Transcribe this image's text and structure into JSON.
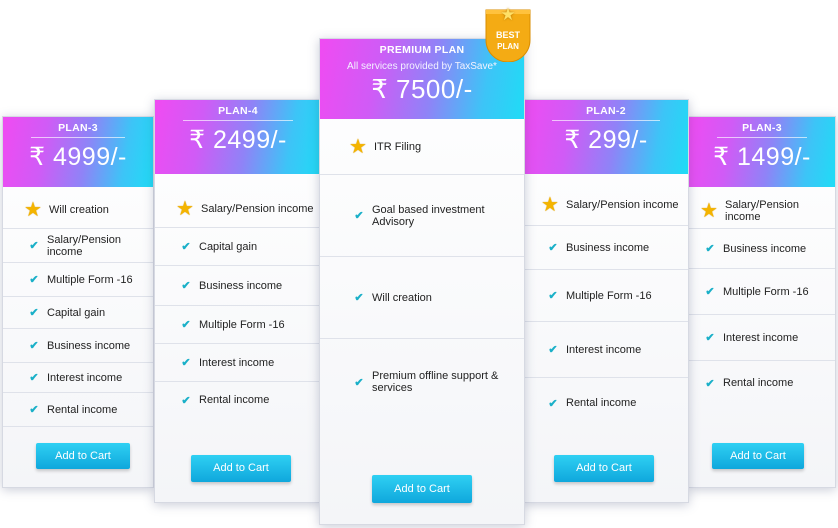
{
  "badge": {
    "line1": "BEST",
    "line2": "PLAN"
  },
  "plans": [
    {
      "name": "PLAN-3",
      "price": "₹ 4999/-",
      "features": [
        {
          "label": "Will creation",
          "icon": "star-icon"
        },
        {
          "label": "Salary/Pension income",
          "icon": "check-icon"
        },
        {
          "label": "Multiple Form -16",
          "icon": "check-icon"
        },
        {
          "label": "Capital gain",
          "icon": "check-icon"
        },
        {
          "label": "Business income",
          "icon": "check-icon"
        },
        {
          "label": "Interest income",
          "icon": "check-icon"
        },
        {
          "label": "Rental income",
          "icon": "check-icon"
        }
      ],
      "button": "Add to Cart"
    },
    {
      "name": "PLAN-4",
      "price": "₹ 2499/-",
      "features": [
        {
          "label": "Salary/Pension income",
          "icon": "star-icon"
        },
        {
          "label": "Capital gain",
          "icon": "check-icon"
        },
        {
          "label": "Business income",
          "icon": "check-icon"
        },
        {
          "label": "Multiple Form -16",
          "icon": "check-icon"
        },
        {
          "label": "Interest income",
          "icon": "check-icon"
        },
        {
          "label": "Rental income",
          "icon": "check-icon"
        }
      ],
      "button": "Add to Cart"
    },
    {
      "name": "PREMIUM PLAN",
      "subtitle": "All services provided by TaxSave*",
      "price": "₹ 7500/-",
      "features": [
        {
          "label": "ITR Filing",
          "icon": "star-icon"
        },
        {
          "label": "Goal based investment Advisory",
          "icon": "check-icon"
        },
        {
          "label": "Will creation",
          "icon": "check-icon"
        },
        {
          "label": "Premium offline support & services",
          "icon": "check-icon"
        }
      ],
      "button": "Add to Cart"
    },
    {
      "name": "PLAN-2",
      "price": "₹ 299/-",
      "features": [
        {
          "label": "Salary/Pension income",
          "icon": "star-icon"
        },
        {
          "label": "Business income",
          "icon": "check-icon"
        },
        {
          "label": "Multiple Form -16",
          "icon": "check-icon"
        },
        {
          "label": "Interest income",
          "icon": "check-icon"
        },
        {
          "label": "Rental income",
          "icon": "check-icon"
        }
      ],
      "button": "Add to Cart"
    },
    {
      "name": "PLAN-3",
      "price": "₹ 1499/-",
      "features": [
        {
          "label": "Salary/Pension income",
          "icon": "star-icon"
        },
        {
          "label": "Business income",
          "icon": "check-icon"
        },
        {
          "label": "Multiple Form -16",
          "icon": "check-icon"
        },
        {
          "label": "Interest income",
          "icon": "check-icon"
        },
        {
          "label": "Rental income",
          "icon": "check-icon"
        }
      ],
      "button": "Add to Cart"
    }
  ],
  "colors": {
    "header_gradient_start": "#f04bf2",
    "header_gradient_end": "#1fdcf6",
    "check": "#1ab0c8",
    "star": "#f4b400",
    "button": "#16b4e4",
    "badge": "#f4ab14"
  }
}
